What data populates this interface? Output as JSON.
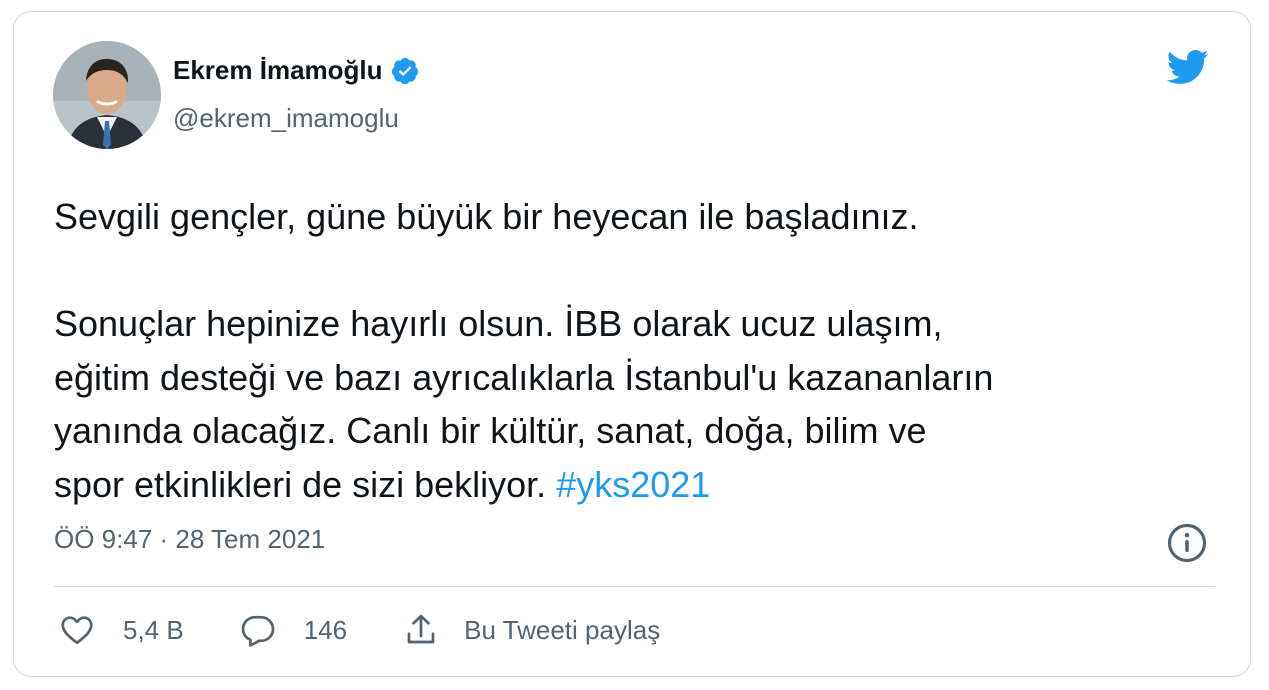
{
  "tweet": {
    "author_name": "Ekrem İmamoğlu",
    "handle": "@ekrem_imamoglu",
    "paragraph1": "Sevgili gençler, güne büyük bir heyecan ile başladınız.",
    "paragraph2_lines": [
      "Sonuçlar hepinize hayırlı olsun. İBB olarak ucuz ulaşım,",
      "eğitim desteği ve bazı ayrıcalıklarla İstanbul'u kazananların",
      "yanında olacağız. Canlı bir kültür, sanat, doğa, bilim ve"
    ],
    "last_line_text": "spor etkinlikleri de sizi bekliyor. ",
    "hashtag": "#yks2021",
    "timestamp": "ÖÖ 9:47 · 28 Tem 2021"
  },
  "actions": {
    "like_count": "5,4 B",
    "reply_count": "146",
    "share_label": "Bu Tweeti paylaş"
  },
  "icons": {
    "twitter": "twitter-bird-icon",
    "verified": "verified-badge-icon",
    "info": "info-icon",
    "like": "heart-icon",
    "reply": "reply-icon",
    "share": "share-icon"
  },
  "colors": {
    "accent": "#1d9bf0",
    "text": "#0f1419",
    "secondary": "#536471",
    "border": "#cfd9de"
  }
}
